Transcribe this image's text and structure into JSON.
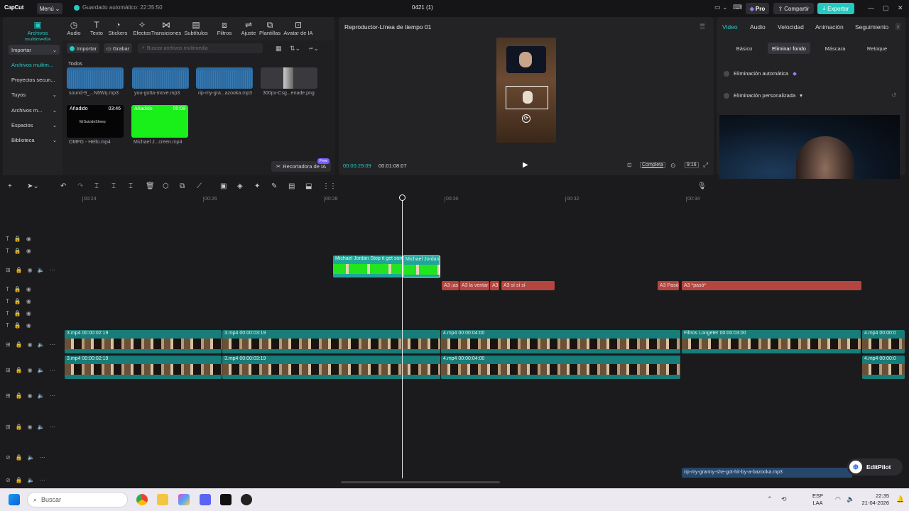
{
  "app": {
    "logo": "CapCut",
    "menu_label": "Menú",
    "autosave": "Guardado automático: 22:35:50",
    "project_title": "0421 (1)",
    "pro_label": "Pro",
    "share_label": "Compartir",
    "export_label": "Exportar"
  },
  "media_tools": [
    {
      "label": "Archivos multimedia",
      "icon": "media-icon"
    },
    {
      "label": "Audio",
      "icon": "audio-icon"
    },
    {
      "label": "Texto",
      "icon": "text-icon"
    },
    {
      "label": "Stickers",
      "icon": "sticker-icon"
    },
    {
      "label": "Efectos",
      "icon": "effects-icon"
    },
    {
      "label": "Transiciones",
      "icon": "transition-icon"
    },
    {
      "label": "Subtítulos",
      "icon": "subtitle-icon"
    },
    {
      "label": "Filtros",
      "icon": "filter-icon"
    },
    {
      "label": "Ajuste",
      "icon": "adjust-icon"
    },
    {
      "label": "Plantillas",
      "icon": "template-icon"
    },
    {
      "label": "Avatar de IA",
      "icon": "avatar-icon"
    }
  ],
  "left_nav": [
    {
      "label": "Importar",
      "has_chevron": true
    },
    {
      "label": "Archivos multim...",
      "has_chevron": false
    },
    {
      "label": "Proyectos secun...",
      "has_chevron": false
    },
    {
      "label": "Tuyos",
      "has_chevron": true
    },
    {
      "label": "Archivos m...",
      "has_chevron": true
    },
    {
      "label": "Espacios",
      "has_chevron": true
    },
    {
      "label": "Biblioteca",
      "has_chevron": true
    }
  ],
  "media_main": {
    "import_label": "Importar",
    "record_label": "Grabar",
    "search_placeholder": "Buscar archivos multimedia",
    "section_label": "Todos",
    "items": [
      {
        "name": "sound-9_...N6Wq.mp3",
        "type": "audio"
      },
      {
        "name": "you-gotta-move.mp3",
        "type": "audio"
      },
      {
        "name": "rip-my-gra...azooka.mp3",
        "type": "audio"
      },
      {
        "name": "300px-Csg...enade.png",
        "type": "image"
      },
      {
        "name": "OMFG - Hello.mp4",
        "badge": "Añadido",
        "duration": "03:46",
        "inner": "MrSuicideSheep"
      },
      {
        "name": "Michael J...creen.mp4",
        "badge": "Añadido",
        "duration": "00:08"
      }
    ],
    "ai_cutter_label": "Recortadora de IA",
    "ai_cutter_badge": "Free"
  },
  "player": {
    "title": "Reproductor-Línea de tiempo 01",
    "current_time": "00:00:29:09",
    "total_time": "00:01:08:07",
    "full_label": "Completa",
    "ratio_label": "9:16"
  },
  "right_panel": {
    "tabs": [
      "Video",
      "Audio",
      "Velocidad",
      "Animación",
      "Seguimiento"
    ],
    "subtabs": [
      "Básico",
      "Eliminar fondo",
      "Máscara",
      "Retoque"
    ],
    "auto_removal": "Eliminación automática",
    "custom_removal": "Eliminación personalizada"
  },
  "timeline": {
    "ruler": [
      "00:24",
      "00:26",
      "00:28",
      "00:30",
      "00:32",
      "00:34"
    ],
    "green_clips": [
      {
        "label": "Michael Jordan Stop it get som"
      },
      {
        "label": "Michael Jordan"
      }
    ],
    "audio_clips": [
      {
        "label": "A3 ¡as"
      },
      {
        "label": "A3 la ventar"
      },
      {
        "label": "A3"
      },
      {
        "label": "A3 sí sí sí"
      },
      {
        "label": "A3 Pasó"
      },
      {
        "label": "A3 *pasó*"
      }
    ],
    "video_row1": [
      {
        "label": "3.mp4  00:00:02:19"
      },
      {
        "label": "3.mp4  00:00:03:19"
      },
      {
        "label": "4.mp4  00:00:04:00"
      },
      {
        "label": "Filtros  Longeter  00:00:03:00"
      },
      {
        "label": "4.mp4  00:00:0"
      }
    ],
    "video_row2": [
      {
        "label": "3.mp4  00:00:02:19"
      },
      {
        "label": "3.mp4  00:00:03:19"
      },
      {
        "label": "4.mp4  00:00:04:00"
      },
      {
        "label": "4.mp4  00:00:0"
      }
    ],
    "music_clip": "rip-my-granny-she-got-hit-by-a-bazooka.mp3",
    "editpilot_label": "EditPilot"
  },
  "taskbar": {
    "search_placeholder": "Buscar",
    "lang": "ESP",
    "lang2": "LAA",
    "time": "22:35",
    "date": "21-04-2026"
  }
}
